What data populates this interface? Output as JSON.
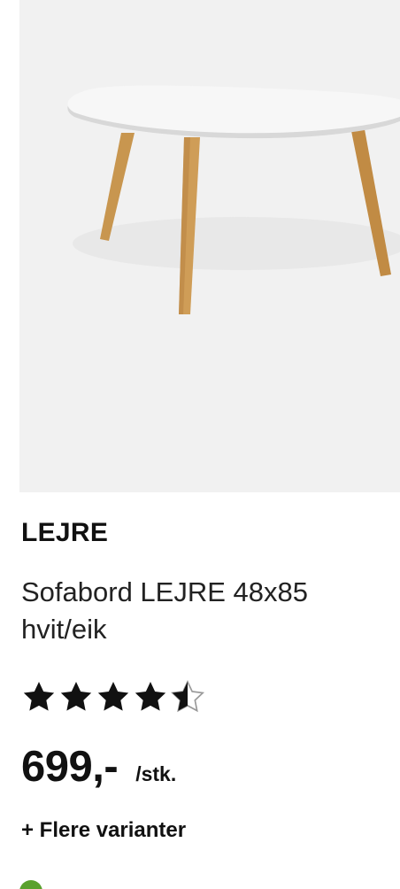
{
  "product": {
    "brand": "LEJRE",
    "title": "Sofabord LEJRE 48x85 hvit/eik",
    "rating": 4.5,
    "rating_max": 5,
    "price": "699,-",
    "price_unit": "/stk.",
    "more_variants": "+ Flere varianter",
    "stock_status": "",
    "image_icon": "coffee-table-photo",
    "colors": {
      "table_top": "#f6f6f6",
      "legs": "#c8964f",
      "stock_ok": "#5aa12d"
    }
  }
}
